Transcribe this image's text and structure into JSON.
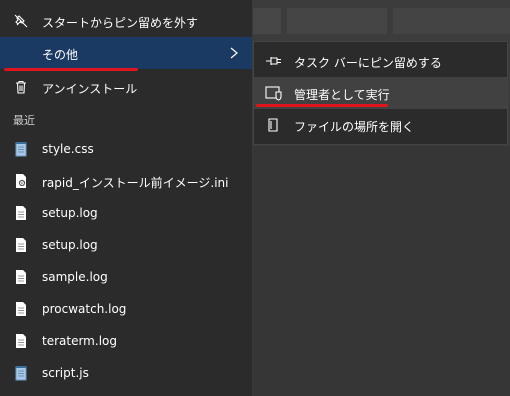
{
  "menu": {
    "top_items": [
      {
        "label": "スタートからピン留めを外す",
        "icon": "unpin-icon"
      },
      {
        "label": "その他",
        "icon": "none",
        "selected": true
      },
      {
        "label": "アンインストール",
        "icon": "trash-icon"
      }
    ],
    "recent_header": "最近",
    "recent_items": [
      {
        "label": "style.css",
        "icon": "notepad-file-icon"
      },
      {
        "label": "rapid_インストール前イメージ.ini",
        "icon": "settings-file-icon"
      },
      {
        "label": "setup.log",
        "icon": "document-icon"
      },
      {
        "label": "setup.log",
        "icon": "document-icon"
      },
      {
        "label": "sample.log",
        "icon": "document-icon"
      },
      {
        "label": "procwatch.log",
        "icon": "document-icon"
      },
      {
        "label": "teraterm.log",
        "icon": "document-icon"
      },
      {
        "label": "script.js",
        "icon": "notepad-file-icon"
      }
    ]
  },
  "submenu": {
    "items": [
      {
        "label": "タスク バーにピン留めする",
        "icon": "pin-icon"
      },
      {
        "label": "管理者として実行",
        "icon": "shield-icon",
        "hover": true
      },
      {
        "label": "ファイルの場所を開く",
        "icon": "file-location-icon"
      }
    ]
  },
  "colors": {
    "menu_bg": "#2b2b2b",
    "selected_bg": "#1b3a63",
    "hover_bg": "#414141",
    "annotation_red": "#e0141e"
  }
}
